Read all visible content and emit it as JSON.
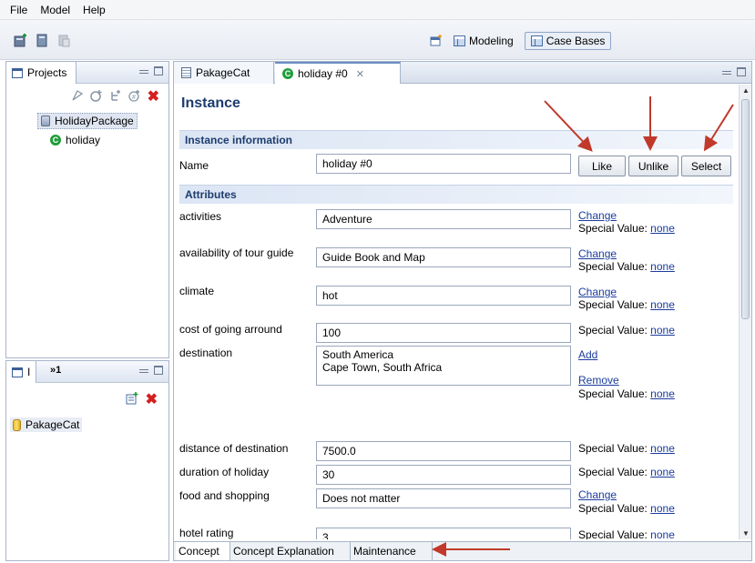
{
  "menu": [
    "File",
    "Model",
    "Help"
  ],
  "toolbar": {
    "icons": [
      "new-project-icon",
      "open-icon",
      "disabled-icon"
    ],
    "perspectives": [
      "Modeling",
      "Case Bases"
    ],
    "active_perspective": "Case Bases"
  },
  "projects_panel": {
    "tab_label": "Projects",
    "tools": [
      "filter-icon",
      "add-concept-icon",
      "add-attribute-icon",
      "add-instance-icon",
      "delete-icon"
    ],
    "tree": [
      {
        "label": "HolidayPackage",
        "icon": "database-icon"
      },
      {
        "label": "holiday",
        "icon": "concept-icon"
      }
    ]
  },
  "casebase_panel": {
    "tab_label": "I",
    "extra_label": "»1",
    "items": [
      "PakageCat"
    ]
  },
  "editor": {
    "tabs": [
      {
        "label": "PakageCat",
        "active": false
      },
      {
        "label": "holiday #0",
        "active": true
      }
    ],
    "title": "Instance",
    "instance_section": "Instance information",
    "name_label": "Name",
    "name_value": "holiday #0",
    "buttons": {
      "like": "Like",
      "unlike": "Unlike",
      "select": "Select"
    },
    "attributes_section": "Attributes",
    "change_label": "Change",
    "add_label": "Add",
    "remove_label": "Remove",
    "special_label": "Special Value:",
    "special_value": "none",
    "attributes": [
      {
        "label": "activities",
        "value": "Adventure"
      },
      {
        "label": "availability of tour guide",
        "value": "Guide Book and Map"
      },
      {
        "label": "climate",
        "value": "hot"
      },
      {
        "label": "cost of going arround",
        "value": "100"
      },
      {
        "label": "destination",
        "values": [
          "South America",
          "Cape Town, South Africa"
        ]
      },
      {
        "label": "distance of destination",
        "value": "7500.0"
      },
      {
        "label": "duration of holiday",
        "value": "30"
      },
      {
        "label": "food and shopping",
        "value": "Does not matter"
      },
      {
        "label": "hotel rating",
        "value": "3"
      }
    ],
    "bottom_tabs": [
      "Concept",
      "Concept Explanation",
      "Maintenance"
    ]
  }
}
